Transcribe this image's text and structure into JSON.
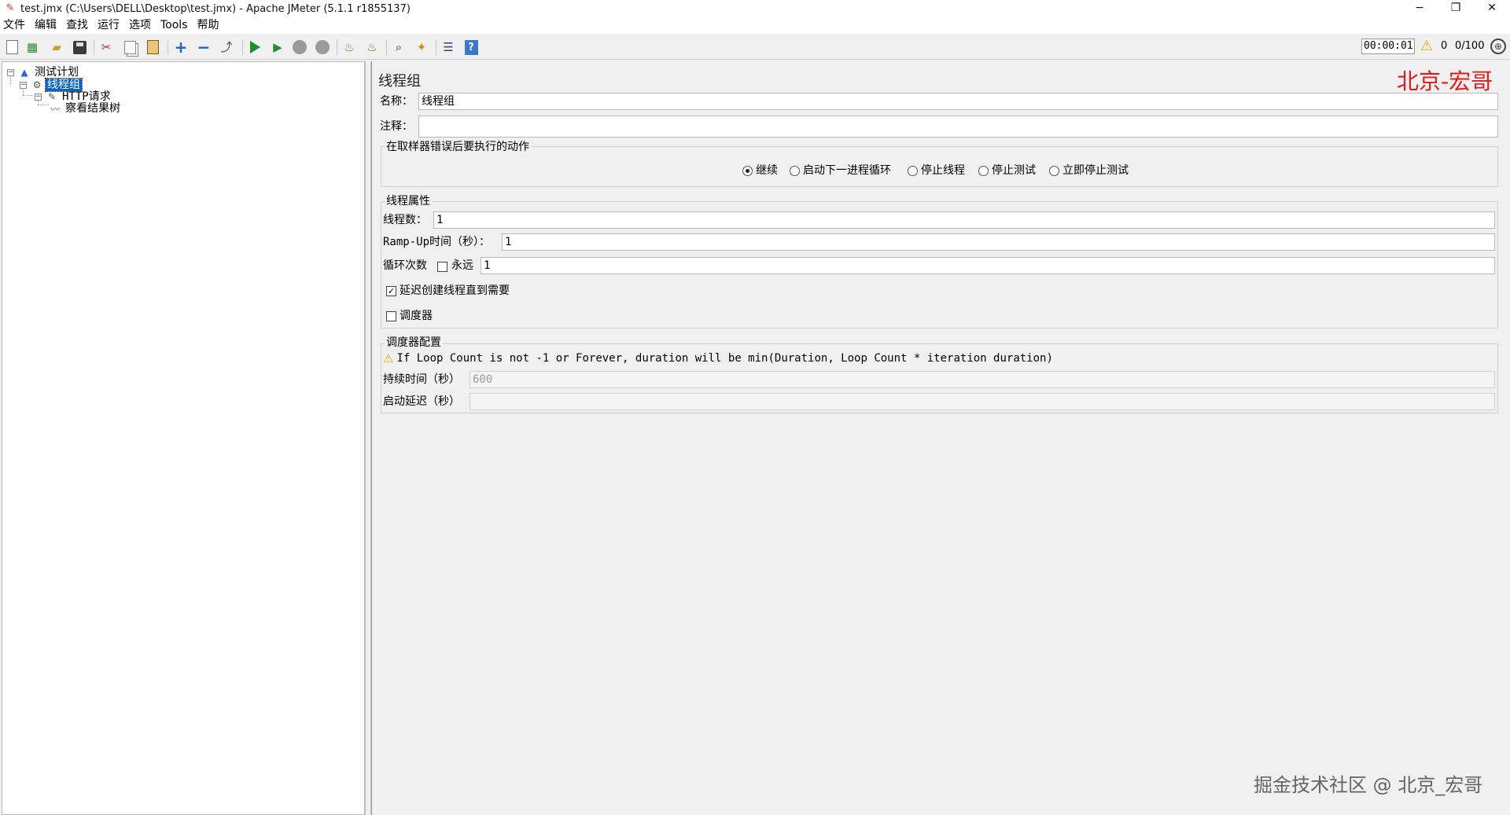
{
  "window": {
    "title": "test.jmx (C:\\Users\\DELL\\Desktop\\test.jmx) - Apache JMeter (5.1.1 r1855137)",
    "minimize": "−",
    "restore": "❐",
    "close": "✕"
  },
  "menu": [
    "文件",
    "编辑",
    "查找",
    "运行",
    "选项",
    "Tools",
    "帮助"
  ],
  "status": {
    "elapsed": "00:00:01",
    "error_count": "0",
    "threads": "0/100"
  },
  "tree": {
    "test_plan": "测试计划",
    "thread_group": "线程组",
    "http_request": "HTTP请求",
    "result_tree": "察看结果树"
  },
  "editor": {
    "title": "线程组",
    "brand": "北京-宏哥",
    "name_label": "名称：",
    "name_value": "线程组",
    "comment_label": "注释：",
    "comment_value": "",
    "error_action": {
      "title": "在取样器错误后要执行的动作",
      "options": [
        "继续",
        "启动下一进程循环",
        "停止线程",
        "停止测试",
        "立即停止测试"
      ],
      "selected": "继续"
    },
    "thread_props": {
      "title": "线程属性",
      "threads_label": "线程数：",
      "threads_value": "1",
      "rampup_label": "Ramp-Up时间（秒）：",
      "rampup_value": "1",
      "loop_label": "循环次数",
      "forever_label": "永远",
      "forever_checked": false,
      "loop_value": "1",
      "delay_label": "延迟创建线程直到需要",
      "delay_checked": true,
      "scheduler_label": "调度器",
      "scheduler_checked": false
    },
    "scheduler": {
      "title": "调度器配置",
      "note": "If Loop Count is not -1 or Forever, duration will be min(Duration, Loop Count * iteration duration)",
      "duration_label": "持续时间（秒）",
      "duration_value": "600",
      "startup_delay_label": "启动延迟（秒）",
      "startup_delay_value": ""
    }
  },
  "watermark": "掘金技术社区 @ 北京_宏哥",
  "colors": {
    "selection": "#0a64c8",
    "brand_red": "#e01b1b",
    "run_green": "#1a8f2a",
    "warning": "#e6a800"
  }
}
